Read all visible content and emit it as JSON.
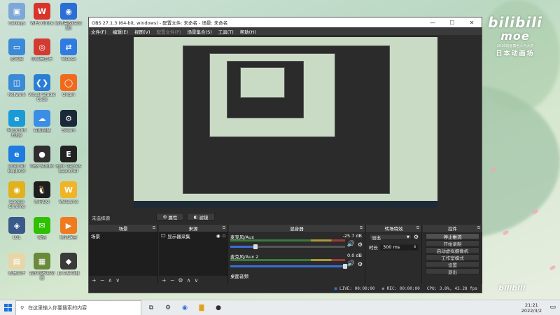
{
  "desktop_icons": [
    {
      "label": "Catkeys",
      "color": "#7ea8d8",
      "glyph": "▣"
    },
    {
      "label": "WPS Office",
      "color": "#d9342b",
      "glyph": "W"
    },
    {
      "label": "腾讯会议(英文版)",
      "color": "#2b6fd6",
      "glyph": "◉"
    },
    {
      "label": "此电脑",
      "color": "#3b8ad8",
      "glyph": "▭"
    },
    {
      "label": "网易云音乐",
      "color": "#d33a31",
      "glyph": "◎"
    },
    {
      "label": "ToDesk",
      "color": "#2f7be0",
      "glyph": "⇄"
    },
    {
      "label": "Network",
      "color": "#3b8ad8",
      "glyph": "◫"
    },
    {
      "label": "Visual Studio Code",
      "color": "#2a7fd4",
      "glyph": "❮❯"
    },
    {
      "label": "Origin",
      "color": "#f06a1e",
      "glyph": "◯"
    },
    {
      "label": "Microsoft Edge",
      "color": "#1b9ad6",
      "glyph": "e"
    },
    {
      "label": "百度网盘",
      "color": "#3a8ee6",
      "glyph": "☁"
    },
    {
      "label": "Steam",
      "color": "#1b2838",
      "glyph": "⚙"
    },
    {
      "label": "Internet Explorer",
      "color": "#1e7be0",
      "glyph": "e"
    },
    {
      "label": "OBS Studio",
      "color": "#302e31",
      "glyph": "●"
    },
    {
      "label": "Epic Games Launcher",
      "color": "#222222",
      "glyph": "E"
    },
    {
      "label": "Google Chrome",
      "color": "#e0b21e",
      "glyph": "◉"
    },
    {
      "label": "腾讯QQ",
      "color": "#1e1e1e",
      "glyph": "🐧"
    },
    {
      "label": "WeGame",
      "color": "#f0b428",
      "glyph": "W"
    },
    {
      "label": "LOL",
      "color": "#3a5a8a",
      "glyph": "◈"
    },
    {
      "label": "微信",
      "color": "#2dc100",
      "glyph": "✉"
    },
    {
      "label": "腾讯课堂",
      "color": "#f07a1e",
      "glyph": "▶"
    },
    {
      "label": "新建文件",
      "color": "#e7d7a8",
      "glyph": "▤"
    },
    {
      "label": "我的世界启动器",
      "color": "#6a8a3a",
      "glyph": "▦"
    },
    {
      "label": "Java启动器",
      "color": "#3a3a3a",
      "glyph": "◆"
    }
  ],
  "bilibili": {
    "logo": "bilibili",
    "sub_logo": "moe",
    "caption": "2016动画角色人气大赏",
    "jp": "日本动画场",
    "small_logo": "bilibili"
  },
  "obs": {
    "title": "OBS 27.1.3 (64-bit, windows) - 配置文件: 未命名 - 场景: 未命名",
    "menu": [
      {
        "label": "文件(F)",
        "enabled": true
      },
      {
        "label": "编辑(E)",
        "enabled": true
      },
      {
        "label": "视图(V)",
        "enabled": true
      },
      {
        "label": "配置文件(P)",
        "enabled": false
      },
      {
        "label": "场景集合(S)",
        "enabled": true
      },
      {
        "label": "工具(T)",
        "enabled": true
      },
      {
        "label": "帮助(H)",
        "enabled": true
      }
    ],
    "no_source_selected": "未选择源",
    "properties_btn": "属性",
    "filters_btn": "滤镜",
    "docks": {
      "scenes": {
        "title": "场景",
        "items": [
          "场景"
        ]
      },
      "sources": {
        "title": "来源",
        "items": [
          "显示器采集"
        ]
      },
      "mixer": {
        "title": "混音器",
        "tracks": [
          {
            "name": "麦克风/Aux",
            "db": "-25.7 dB",
            "level": 0.22
          },
          {
            "name": "麦克风/Aux 2",
            "db": "0.0 dB",
            "level": 1.0
          },
          {
            "name": "桌面音频",
            "db": "",
            "level": 0
          }
        ]
      },
      "transitions": {
        "title": "转场特效",
        "type": "淡出",
        "duration_label": "时长",
        "duration": "300 ms"
      },
      "controls": {
        "title": "控件",
        "buttons": [
          "停止推流",
          "开始录制",
          "启动虚拟摄像机",
          "工作室模式",
          "设置",
          "退出"
        ]
      }
    },
    "status": {
      "live": "LIVE: 00:00:00",
      "rec": "REC: 00:00:00",
      "cpu": "CPU: 3.8%, 43.28 fps"
    }
  },
  "taskbar": {
    "search_placeholder": "在这里输入你要搜索的内容",
    "time": "21:21",
    "date": "2022/3/2"
  }
}
